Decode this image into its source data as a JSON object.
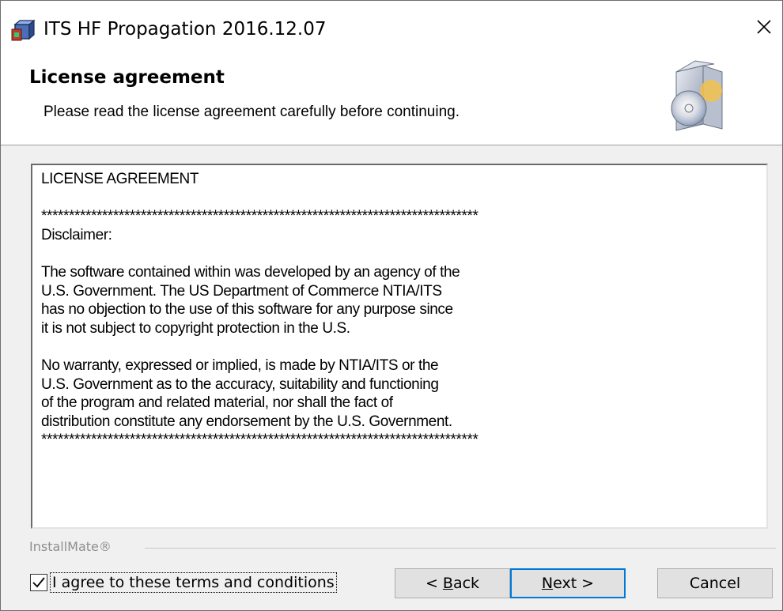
{
  "window": {
    "title": "ITS HF Propagation 2016.12.07"
  },
  "header": {
    "title": "License agreement",
    "subtitle": "Please read the license agreement carefully before continuing."
  },
  "license": {
    "text": "LICENSE AGREEMENT\n\n*******************************************************************************\nDisclaimer:\n\nThe software contained within was developed by an agency of the\nU.S. Government. The US Department of Commerce NTIA/ITS\nhas no objection to the use of this software for any purpose since\nit is not subject to copyright protection in the U.S.\n\nNo warranty, expressed or implied, is made by NTIA/ITS or the\nU.S. Government as to the accuracy, suitability and functioning\nof the program and related material, nor shall the fact of\ndistribution constitute any endorsement by the U.S. Government.\n*******************************************************************************"
  },
  "footer": {
    "brand": "InstallMate®",
    "agree_label": "I agree to these terms and conditions",
    "agree_checked": true
  },
  "buttons": {
    "back_prefix": "< ",
    "back_access": "B",
    "back_rest": "ack",
    "next_access": "N",
    "next_rest": "ext >",
    "cancel": "Cancel"
  },
  "icons": {
    "app": "installer-package-icon",
    "close": "close-icon",
    "header": "software-box-cd-icon",
    "check": "checkmark-icon"
  }
}
